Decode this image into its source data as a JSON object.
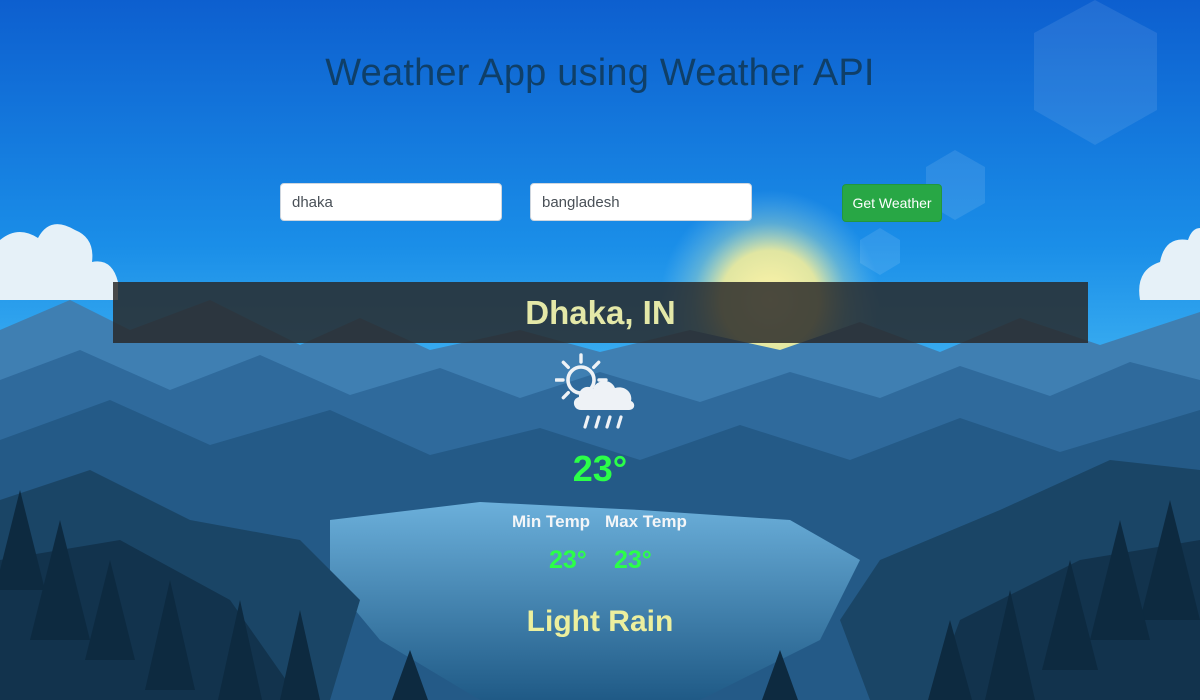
{
  "app": {
    "title": "Weather App using Weather API"
  },
  "form": {
    "city_value": "dhaka",
    "country_value": "bangladesh",
    "submit_label": "Get Weather"
  },
  "result": {
    "location": "Dhaka, IN",
    "icon": "partly-cloudy-rain-icon",
    "temperature": "23°",
    "min_label": "Min Temp",
    "max_label": "Max Temp",
    "min_value": "23°",
    "max_value": "23°",
    "description": "Light Rain"
  },
  "colors": {
    "title": "#0f3f68",
    "button": "#28a745",
    "temperature": "#2bff48",
    "location": "#e4e8a8",
    "description": "#ecef9e",
    "banner": "#282828"
  }
}
